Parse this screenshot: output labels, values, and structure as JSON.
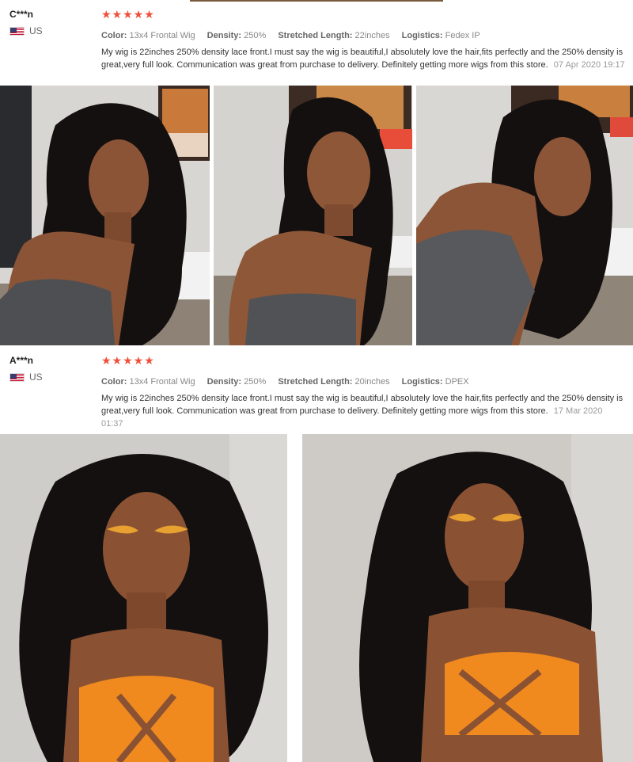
{
  "reviews": [
    {
      "name": "C***n",
      "country": "US",
      "stars": "★★★★★",
      "attributes": [
        {
          "label": "Color:",
          "value": "13x4 Frontal Wig"
        },
        {
          "label": "Density:",
          "value": "250%"
        },
        {
          "label": "Stretched Length:",
          "value": "22inches"
        },
        {
          "label": "Logistics:",
          "value": "Fedex IP"
        }
      ],
      "text": "My wig is 22inches 250% density lace front.I must say the wig is beautiful,I absolutely love the hair,fits perfectly and the 250% density is great,very full look. Communication was great from purchase to delivery. Definitely getting more wigs from this store.",
      "date": "07 Apr 2020 19:17"
    },
    {
      "name": "A***n",
      "country": "US",
      "stars": "★★★★★",
      "attributes": [
        {
          "label": "Color:",
          "value": "13x4 Frontal Wig"
        },
        {
          "label": "Density:",
          "value": "250%"
        },
        {
          "label": "Stretched Length:",
          "value": "20inches"
        },
        {
          "label": "Logistics:",
          "value": "DPEX"
        }
      ],
      "text": "My wig is 22inches 250% density lace front.I must say the wig is beautiful,I absolutely love the hair,fits perfectly and the 250% density is great,very full look. Communication was great from purchase to delivery. Definitely getting more wigs from this store.",
      "date": "17 Mar 2020 01:37"
    }
  ],
  "colors": {
    "star": "#f04e3a",
    "muted": "#888888",
    "label": "#666666"
  }
}
